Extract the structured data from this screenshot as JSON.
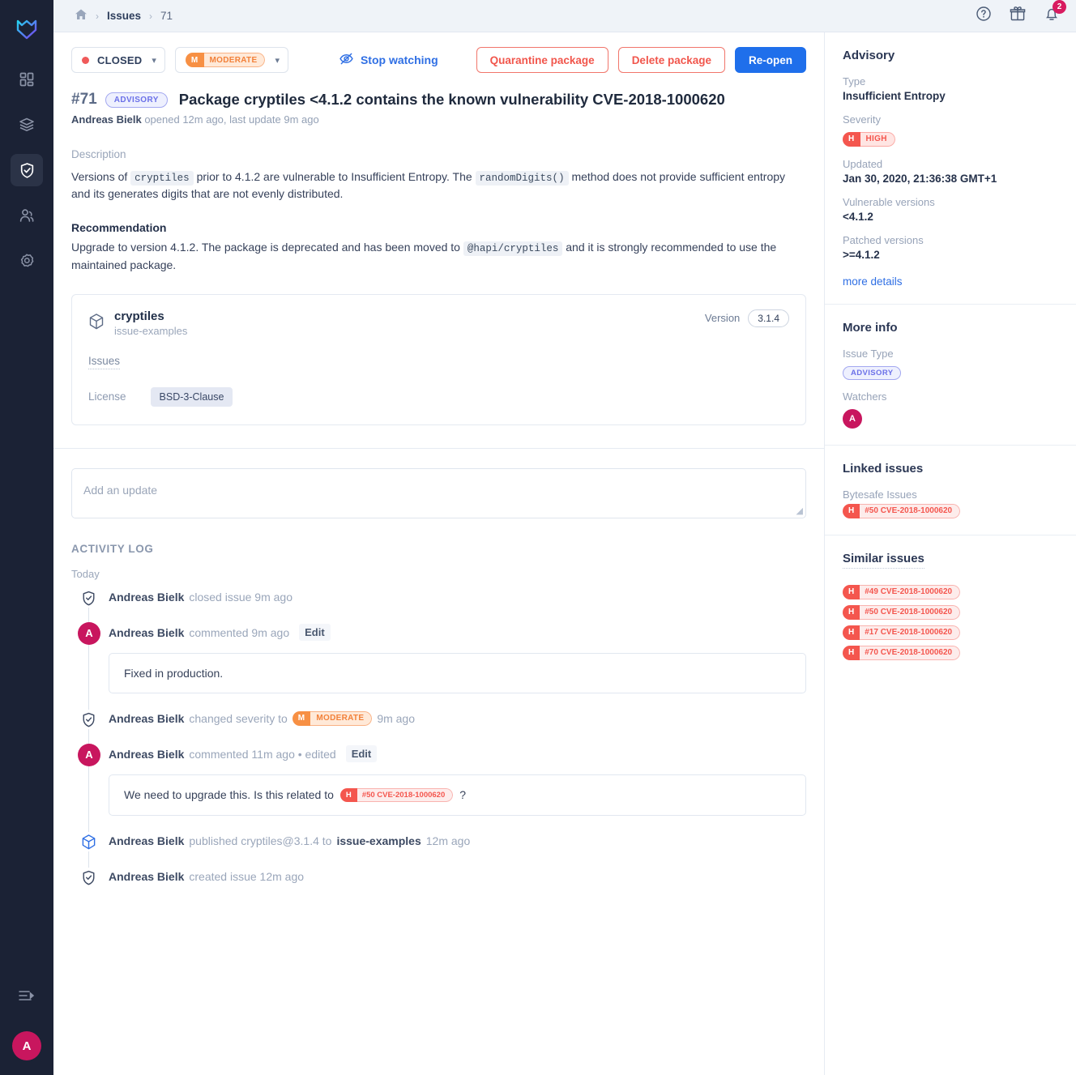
{
  "left_nav": {
    "logo_name": "bytesafe-logo",
    "items": [
      {
        "name": "dashboard",
        "icon": "grid-icon",
        "active": false
      },
      {
        "name": "packages",
        "icon": "layers-icon",
        "active": false
      },
      {
        "name": "issues",
        "icon": "shield-check-icon",
        "active": true
      },
      {
        "name": "members",
        "icon": "users-icon",
        "active": false
      },
      {
        "name": "settings",
        "icon": "gear-icon",
        "active": false
      }
    ],
    "collapse_icon": "collapse-panel-icon",
    "avatar_initial": "A"
  },
  "topbar": {
    "home_icon": "home-icon",
    "breadcrumb": [
      "Issues",
      "71"
    ],
    "help_icon": "help-circle-icon",
    "gift_icon": "gift-icon",
    "bell_icon": "bell-icon",
    "notification_count": "2"
  },
  "toolbar": {
    "status_label": "CLOSED",
    "status_dot_color": "#f05a5a",
    "severity_letter": "M",
    "severity_label": "MODERATE",
    "watch_label": "Stop watching",
    "watch_icon": "eye-off-icon",
    "quarantine_label": "Quarantine package",
    "delete_label": "Delete package",
    "reopen_label": "Re-open",
    "primary_color": "#1f6feb",
    "danger_color": "#f1564c"
  },
  "issue": {
    "number": "#71",
    "tag": "ADVISORY",
    "title": "Package cryptiles <4.1.2 contains the known vulnerability CVE-2018-1000620",
    "author": "Andreas Bielk",
    "meta": "opened 12m ago, last update 9m ago",
    "description_label": "Description",
    "description": {
      "p1_a": "Versions of",
      "code1": "cryptiles",
      "p1_b": "prior to 4.1.2 are vulnerable to Insufficient Entropy. The",
      "code2": "randomDigits()",
      "p1_c": "method does not provide sufficient entropy and its generates digits that are not evenly distributed."
    },
    "recommendation_label": "Recommendation",
    "recommendation": {
      "r_a": "Upgrade to version 4.1.2. The package is deprecated and has been moved to",
      "code1": "@hapi/cryptiles",
      "r_b": "and it is strongly recommended to use the maintained package."
    }
  },
  "package_card": {
    "icon": "package-cube-icon",
    "name": "cryptiles",
    "registry": "issue-examples",
    "version_label": "Version",
    "version": "3.1.4",
    "issues_label": "Issues",
    "license_label": "License",
    "license_value": "BSD-3-Clause"
  },
  "update_box": {
    "placeholder": "Add an update"
  },
  "activity": {
    "heading": "ACTIVITY LOG",
    "day": "Today",
    "entries": [
      {
        "icon": "shield-check-icon",
        "author": "Andreas Bielk",
        "action": "closed issue 9m ago"
      },
      {
        "icon": "avatar",
        "avatar_initial": "A",
        "author": "Andreas Bielk",
        "action": "commented 9m ago",
        "edit_label": "Edit",
        "comment": "Fixed in production."
      },
      {
        "icon": "shield-check-icon",
        "author": "Andreas Bielk",
        "action": "changed severity to",
        "severity_letter": "M",
        "severity_label": "MODERATE",
        "action_tail": "9m ago"
      },
      {
        "icon": "avatar",
        "avatar_initial": "A",
        "author": "Andreas Bielk",
        "action": "commented 11m ago • edited",
        "edit_label": "Edit",
        "comment_a": "We need to upgrade this. Is this related to",
        "chip_letter": "H",
        "chip_label": "#50 CVE-2018-1000620",
        "comment_b": "?"
      },
      {
        "icon": "package-cube-icon",
        "author": "Andreas Bielk",
        "action": "published cryptiles@3.1.4 to",
        "bold_target": "issue-examples",
        "action_tail": "12m ago"
      },
      {
        "icon": "shield-check-icon",
        "author": "Andreas Bielk",
        "action": "created issue 12m ago"
      }
    ]
  },
  "sidepanel": {
    "advisory": {
      "title": "Advisory",
      "type_label": "Type",
      "type_value": "Insufficient Entropy",
      "severity_label": "Severity",
      "severity_letter": "H",
      "severity_value": "HIGH",
      "updated_label": "Updated",
      "updated_value": "Jan 30, 2020, 21:36:38 GMT+1",
      "vulnerable_label": "Vulnerable versions",
      "vulnerable_value": "<4.1.2",
      "patched_label": "Patched versions",
      "patched_value": ">=4.1.2",
      "more_details": "more details"
    },
    "more_info": {
      "title": "More info",
      "issue_type_label": "Issue Type",
      "issue_type_value": "ADVISORY",
      "watchers_label": "Watchers",
      "watcher_initial": "A"
    },
    "linked": {
      "title": "Linked issues",
      "subtitle": "Bytesafe Issues",
      "items": [
        {
          "letter": "H",
          "label": "#50 CVE-2018-1000620"
        }
      ]
    },
    "similar": {
      "title": "Similar issues",
      "items": [
        {
          "letter": "H",
          "label": "#49 CVE-2018-1000620"
        },
        {
          "letter": "H",
          "label": "#50 CVE-2018-1000620"
        },
        {
          "letter": "H",
          "label": "#17 CVE-2018-1000620"
        },
        {
          "letter": "H",
          "label": "#70 CVE-2018-1000620"
        }
      ]
    }
  }
}
